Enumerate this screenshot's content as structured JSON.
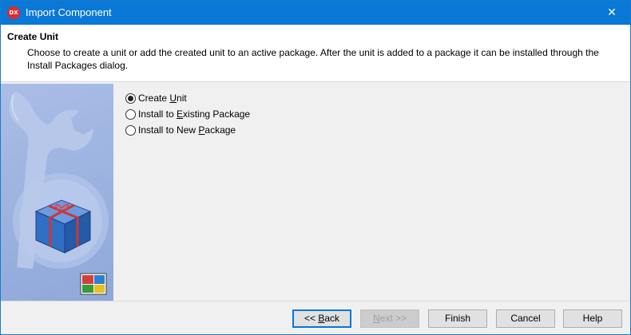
{
  "window": {
    "title": "Import Component",
    "app_icon_text": "DX",
    "close_glyph": "✕"
  },
  "header": {
    "title": "Create Unit",
    "description": "Choose to create a unit or add the created unit to an active package. After the unit is added to a package it can be installed through the Install Packages dialog."
  },
  "options": [
    {
      "pre": "Create ",
      "accel": "U",
      "post": "nit",
      "checked": true
    },
    {
      "pre": "Install to ",
      "accel": "E",
      "post": "xisting Package",
      "checked": false
    },
    {
      "pre": "Install to New ",
      "accel": "P",
      "post": "ackage",
      "checked": false
    }
  ],
  "buttons": {
    "back": {
      "pre": "<< ",
      "accel": "B",
      "post": "ack"
    },
    "next": {
      "pre": "",
      "accel": "N",
      "post": "ext >>"
    },
    "finish": "Finish",
    "cancel": "Cancel",
    "help": "Help"
  },
  "colors": {
    "titlebar": "#0a78d7",
    "side_panel": "#9cb3e0",
    "box_blue": "#2f6fc4",
    "ribbon_red": "#c8383a"
  },
  "icons": {
    "side_illustration": "wrench-and-package-box",
    "badge": "windows-tile-icon"
  }
}
